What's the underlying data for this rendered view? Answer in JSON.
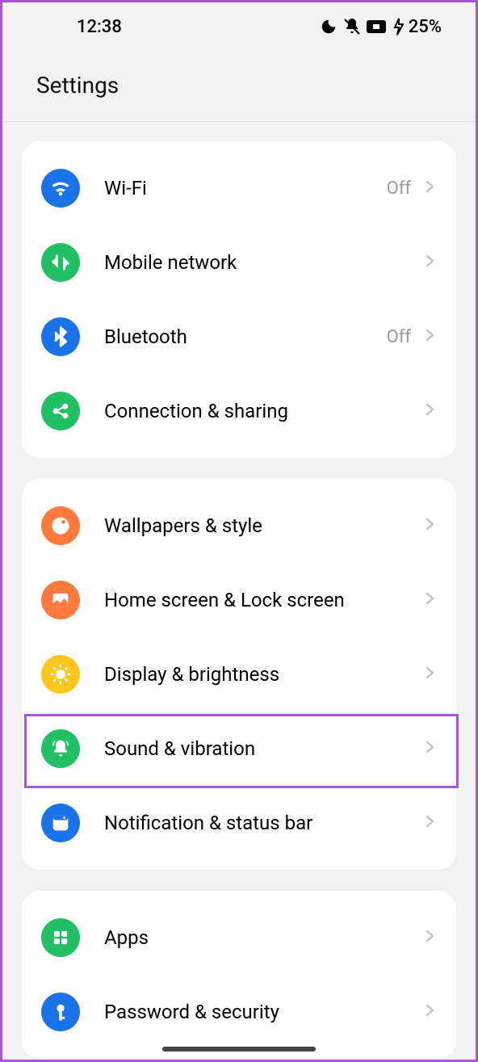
{
  "status": {
    "time": "12:38",
    "battery": "25%"
  },
  "title": "Settings",
  "groups": [
    {
      "rows": [
        {
          "id": "wifi",
          "label": "Wi-Fi",
          "status": "Off",
          "icon": "wifi",
          "color": "c-blue"
        },
        {
          "id": "mobile",
          "label": "Mobile network",
          "status": "",
          "icon": "mobile",
          "color": "c-green"
        },
        {
          "id": "bluetooth",
          "label": "Bluetooth",
          "status": "Off",
          "icon": "bt",
          "color": "c-blue"
        },
        {
          "id": "connection",
          "label": "Connection & sharing",
          "status": "",
          "icon": "share",
          "color": "c-green"
        }
      ]
    },
    {
      "rows": [
        {
          "id": "wallpaper",
          "label": "Wallpapers & style",
          "status": "",
          "icon": "palette",
          "color": "c-orange"
        },
        {
          "id": "homescreen",
          "label": "Home screen & Lock screen",
          "status": "",
          "icon": "image",
          "color": "c-orange"
        },
        {
          "id": "display",
          "label": "Display & brightness",
          "status": "",
          "icon": "sun",
          "color": "c-yellow"
        },
        {
          "id": "sound",
          "label": "Sound & vibration",
          "status": "",
          "icon": "bell",
          "color": "c-green",
          "highlight": true
        },
        {
          "id": "notif",
          "label": "Notification & status bar",
          "status": "",
          "icon": "panel",
          "color": "c-blue"
        }
      ]
    },
    {
      "rows": [
        {
          "id": "apps",
          "label": "Apps",
          "status": "",
          "icon": "apps",
          "color": "c-green"
        },
        {
          "id": "password",
          "label": "Password & security",
          "status": "",
          "icon": "key",
          "color": "c-blue"
        }
      ]
    }
  ]
}
